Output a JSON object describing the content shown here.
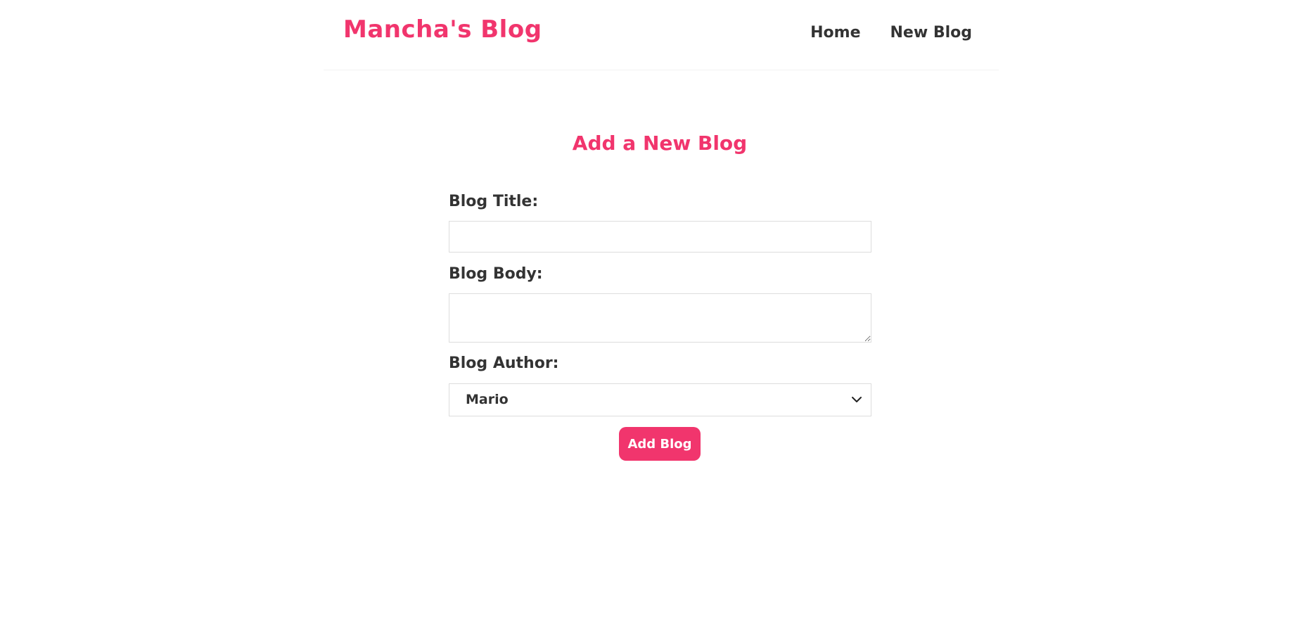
{
  "navbar": {
    "brand": "Mancha's Blog",
    "links": [
      {
        "label": "Home"
      },
      {
        "label": "New Blog"
      }
    ]
  },
  "form": {
    "heading": "Add a New Blog",
    "title_label": "Blog Title:",
    "title_value": "",
    "body_label": "Blog Body:",
    "body_value": "",
    "author_label": "Blog Author:",
    "author_selected": "Mario",
    "author_dropdown_icon": "chevron-down-icon",
    "submit_label": "Add Blog"
  },
  "colors": {
    "accent": "#f1356d",
    "text": "#333333",
    "border": "#dddddd"
  }
}
